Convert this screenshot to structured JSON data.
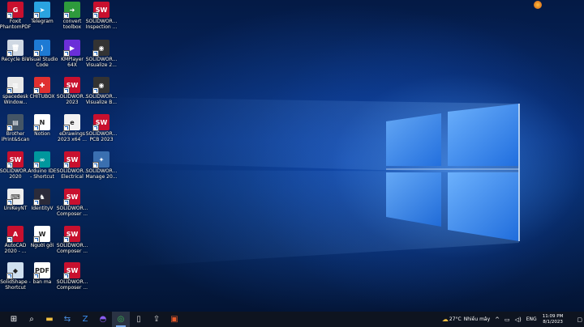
{
  "desktop_icons": [
    {
      "id": "foxit",
      "label": "Foxit\nPhantomPDF",
      "icon": "pdf-icon",
      "color": "#c8102e",
      "glyph": "G"
    },
    {
      "id": "telegram",
      "label": "Telegram",
      "icon": "telegram-icon",
      "color": "#2aa3e0",
      "glyph": "➤"
    },
    {
      "id": "convert",
      "label": "convert\ntoolbox",
      "icon": "arrow-right-icon",
      "color": "#2e9a3c",
      "glyph": "➜"
    },
    {
      "id": "sw-inspection",
      "label": "SOLIDWOR...\nInspection ...",
      "icon": "solidworks-icon",
      "color": "#c8102e",
      "glyph": "SW",
      "badge": "2023"
    },
    {
      "id": "recycle",
      "label": "Recycle Bin",
      "icon": "recycle-bin-icon",
      "color": "#cfd8e3",
      "glyph": "🗑"
    },
    {
      "id": "vscode",
      "label": "Visual Studio\nCode",
      "icon": "vscode-icon",
      "color": "#1e7ad4",
      "glyph": "⟩"
    },
    {
      "id": "kmplayer",
      "label": "KMPlayer 64X",
      "icon": "kmplayer-icon",
      "color": "#6b2fd8",
      "glyph": "▶"
    },
    {
      "id": "sw-visualize",
      "label": "SOLIDWOR...\nVisualize 2...",
      "icon": "solidworks-visualize-icon",
      "color": "#333333",
      "glyph": "◉",
      "badge": "2023"
    },
    {
      "id": "spacedesk",
      "label": "spacedesk\nWindow...",
      "icon": "spacedesk-icon",
      "color": "#e8e8e8",
      "glyph": "▥"
    },
    {
      "id": "chitubox",
      "label": "CHITUBOX",
      "icon": "chitubox-icon",
      "color": "#e03030",
      "glyph": "✚"
    },
    {
      "id": "sw-2023",
      "label": "SOLIDWOR...\n2023",
      "icon": "solidworks-icon",
      "color": "#c8102e",
      "glyph": "SW",
      "badge": "2023"
    },
    {
      "id": "sw-visualize-b",
      "label": "SOLIDWOR...\nVisualize B...",
      "icon": "solidworks-visualize-icon",
      "color": "#333333",
      "glyph": "◉",
      "badge": "2023"
    },
    {
      "id": "brother",
      "label": "Brother\niPrint&Scan",
      "icon": "printer-icon",
      "color": "#445566",
      "glyph": "▤"
    },
    {
      "id": "notion",
      "label": "Notion",
      "icon": "notion-icon",
      "color": "#ffffff",
      "glyph": "N",
      "dark": true
    },
    {
      "id": "edrawings",
      "label": "eDrawings\n2023 x64 ...",
      "icon": "edrawings-icon",
      "color": "#f2f2f2",
      "glyph": "e",
      "dark": true,
      "badge": "2023"
    },
    {
      "id": "sw-pcb",
      "label": "SOLIDWOR...\nPCB 2023",
      "icon": "solidworks-icon",
      "color": "#c8102e",
      "glyph": "SW",
      "badge": "2023"
    },
    {
      "id": "sw-2020",
      "label": "SOLIDWOR...\n2020",
      "icon": "solidworks-icon",
      "color": "#c8102e",
      "glyph": "SW",
      "badge": "2020"
    },
    {
      "id": "arduino",
      "label": "Arduino IDE\n- Shortcut",
      "icon": "arduino-icon",
      "color": "#00979d",
      "glyph": "∞"
    },
    {
      "id": "sw-electrical",
      "label": "SOLIDWOR...\nElectrical",
      "icon": "solidworks-icon",
      "color": "#c8102e",
      "glyph": "SW",
      "badge": "2023"
    },
    {
      "id": "sw-manage",
      "label": "SOLIDWOR...\nManage 20...",
      "icon": "solidworks-manage-icon",
      "color": "#3a6fb0",
      "glyph": "✦"
    },
    {
      "id": "unikey",
      "label": "UniKeyNT",
      "icon": "keyboard-icon",
      "color": "#eeeeee",
      "glyph": "⌨",
      "dark": true
    },
    {
      "id": "identityv",
      "label": "IdentityV",
      "icon": "game-icon",
      "color": "#2b2b3a",
      "glyph": "♞"
    },
    {
      "id": "sw-composer1",
      "label": "SOLIDWOR...\nComposer ...",
      "icon": "solidworks-composer-icon",
      "color": "#c8102e",
      "glyph": "SW",
      "badge": "2023"
    },
    {
      "id": "autocad",
      "label": "AutoCAD\n2020 - ...",
      "icon": "autocad-icon",
      "color": "#c8102e",
      "glyph": "A"
    },
    {
      "id": "nguoi-goi",
      "label": "Người gởi",
      "icon": "word-document-icon",
      "color": "#ffffff",
      "glyph": "W",
      "dark": true
    },
    {
      "id": "sw-composer2",
      "label": "SOLIDWOR...\nComposer ...",
      "icon": "solidworks-composer-icon",
      "color": "#c8102e",
      "glyph": "SW",
      "badge": "2023"
    },
    {
      "id": "solidshape",
      "label": "SolidShape -\nShortcut",
      "icon": "solidshape-icon",
      "color": "#cfe0f0",
      "glyph": "◆",
      "dark": true
    },
    {
      "id": "ban-ma",
      "label": "ban ma",
      "icon": "pdf-file-icon",
      "color": "#ffffff",
      "glyph": "PDF",
      "dark": true
    },
    {
      "id": "sw-composer3",
      "label": "SOLIDWOR...\nComposer ...",
      "icon": "solidworks-composer-icon",
      "color": "#c8102e",
      "glyph": "SW",
      "badge": "2023"
    }
  ],
  "taskbar": {
    "apps": [
      {
        "id": "start",
        "icon": "windows-start-icon"
      },
      {
        "id": "search",
        "icon": "search-icon"
      },
      {
        "id": "explorer",
        "icon": "folder-icon"
      },
      {
        "id": "teamviewer",
        "icon": "teamviewer-icon"
      },
      {
        "id": "zalo",
        "icon": "zalo-icon"
      },
      {
        "id": "messenger",
        "icon": "messenger-icon"
      },
      {
        "id": "chrome",
        "icon": "chrome-icon",
        "active": true
      },
      {
        "id": "usb",
        "icon": "usb-drive-icon"
      },
      {
        "id": "uploader",
        "icon": "upload-icon"
      },
      {
        "id": "app-orange",
        "icon": "app-icon"
      }
    ],
    "weather_temp": "27°C",
    "weather_desc": "Nhiều mây",
    "language": "ENG",
    "time": "11:09 PM",
    "date": "8/1/2023"
  }
}
